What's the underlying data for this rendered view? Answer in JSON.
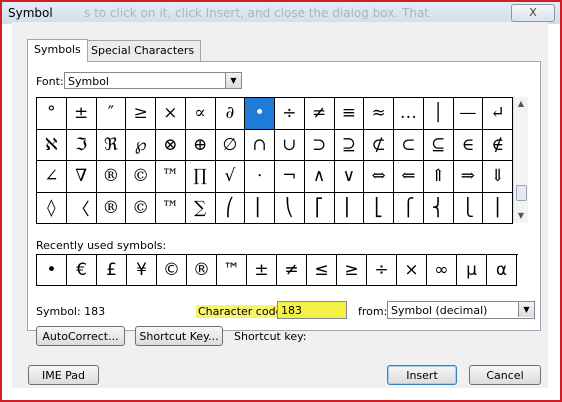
{
  "window": {
    "title": "Symbol",
    "ghost_text": "s to click on it, click Insert, and close the dialog box. That",
    "close_label": "X"
  },
  "tabs": [
    {
      "label": "Symbols"
    },
    {
      "label": "Special Characters"
    }
  ],
  "font": {
    "label": "Font:",
    "value": "Symbol"
  },
  "grid": [
    [
      "°",
      "±",
      "″",
      "≥",
      "×",
      "∝",
      "∂",
      "•",
      "÷",
      "≠",
      "≡",
      "≈",
      "…",
      "│",
      "—",
      "↵"
    ],
    [
      "ℵ",
      "ℑ",
      "ℜ",
      "℘",
      "⊗",
      "⊕",
      "∅",
      "∩",
      "∪",
      "⊃",
      "⊇",
      "⊄",
      "⊂",
      "⊆",
      "∈",
      "∉"
    ],
    [
      "∠",
      "∇",
      "®",
      "©",
      "™",
      "∏",
      "√",
      "⋅",
      "¬",
      "∧",
      "∨",
      "⇔",
      "⇐",
      "⇑",
      "⇒",
      "⇓"
    ],
    [
      "◊",
      "〈",
      "®",
      "©",
      "™",
      "∑",
      "⎛",
      "⎜",
      "⎝",
      "⎡",
      "⎢",
      "⎣",
      "⎧",
      "⎨",
      "⎩",
      "⎪"
    ]
  ],
  "selected": {
    "row": 0,
    "col": 7
  },
  "recent": {
    "label": "Recently used symbols:",
    "symbols": [
      "•",
      "€",
      "£",
      "¥",
      "©",
      "®",
      "™",
      "±",
      "≠",
      "≤",
      "≥",
      "÷",
      "×",
      "∞",
      "μ",
      "α"
    ]
  },
  "symbol_info": "Symbol: 183",
  "char_code": {
    "label": "Character code:",
    "value": "183"
  },
  "from": {
    "label": "from:",
    "value": "Symbol (decimal)"
  },
  "buttons": {
    "autocorrect": "AutoCorrect...",
    "shortcut_key": "Shortcut Key...",
    "ime_pad": "IME Pad",
    "insert": "Insert",
    "cancel": "Cancel"
  },
  "shortcut_key_label": "Shortcut key:",
  "colors": {
    "selection": "#1e7bd7",
    "highlight": "#f5f247",
    "border_red": "#cf1f25"
  }
}
